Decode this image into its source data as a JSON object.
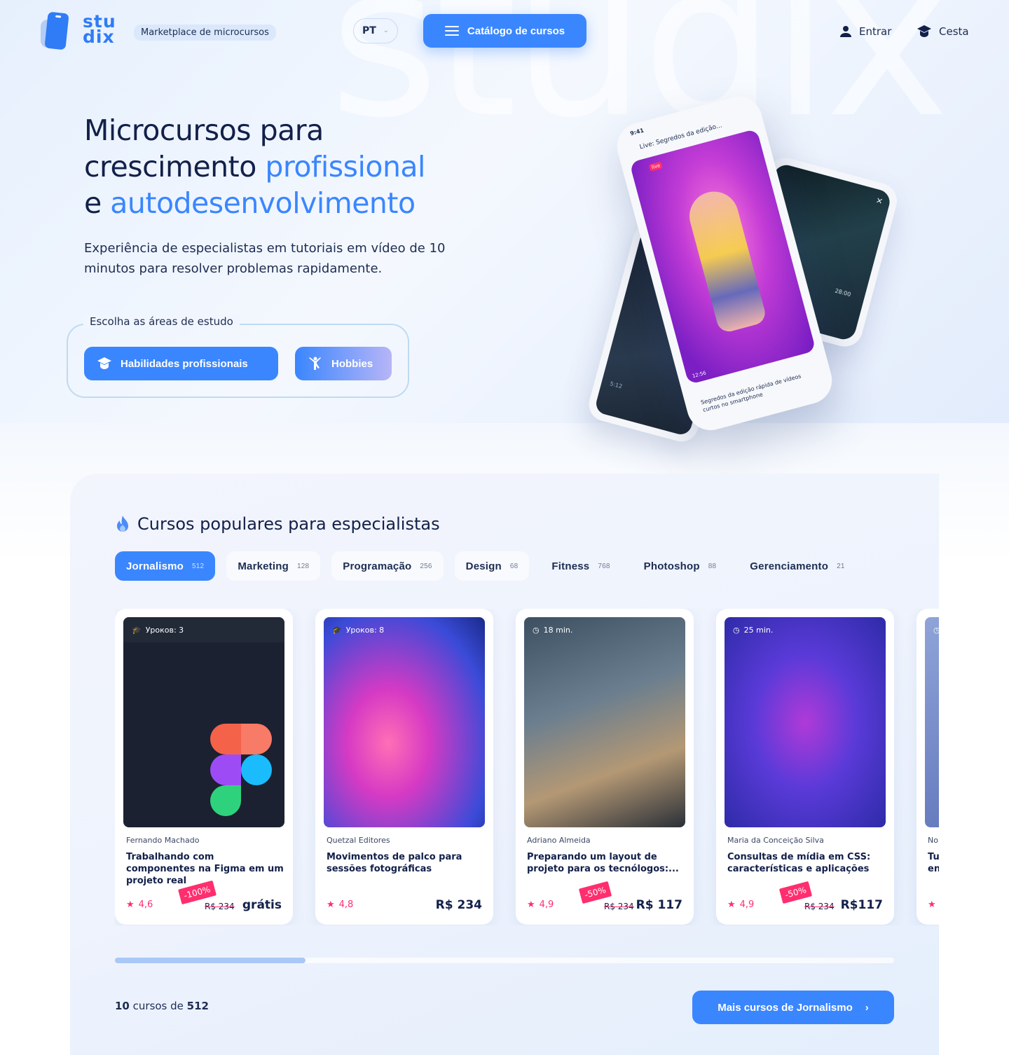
{
  "header": {
    "logo_line1": "stu",
    "logo_line2": "dix",
    "tagline": "Marketplace de microcursos",
    "language": "PT",
    "catalog_label": "Catálogo de cursos",
    "login_label": "Entrar",
    "cart_label": "Cesta",
    "watermark": "studix"
  },
  "hero": {
    "title_line1": "Microcursos para",
    "title_line2_a": "crescimento ",
    "title_line2_b": "profissional",
    "title_line3_a": "e ",
    "title_line3_b": "autodesenvolvimento",
    "subtitle": "Experiência de especialistas em tutoriais em vídeo de 10 minutos para resolver problemas rapidamente.",
    "areas_label": "Escolha as áreas de estudo",
    "areas": [
      {
        "label": "Habilidades profissionais",
        "icon": "graduation-cap-icon"
      },
      {
        "label": "Hobbies",
        "icon": "dance-icon"
      }
    ],
    "phone": {
      "time": "9:41",
      "live_title": "Live: Segredos da edição...",
      "live_tag": "live",
      "caption": "Segredos da edição rápida de vídeos curtos no smartphone",
      "timer": "12:56",
      "right_timer": "28:00",
      "left_timer": "5:12"
    }
  },
  "courses": {
    "title": "Cursos populares para especialistas",
    "tabs": [
      {
        "label": "Jornalismo",
        "count": "512",
        "active": true
      },
      {
        "label": "Marketing",
        "count": "128"
      },
      {
        "label": "Programação",
        "count": "256"
      },
      {
        "label": "Design",
        "count": "68"
      },
      {
        "label": "Fitness",
        "count": "768"
      },
      {
        "label": "Photoshop",
        "count": "88"
      },
      {
        "label": "Gerenciamento",
        "count": "21"
      }
    ],
    "cards": [
      {
        "badge": "Уроков: 3",
        "badge_icon": "graduation-cap-icon",
        "author": "Fernando Machado",
        "title": "Trabalhando com componentes na Figma em um projeto real",
        "rating": "4,6",
        "discount": "-100%",
        "old_price": "R$ 234",
        "price": "grátis"
      },
      {
        "badge": "Уроков: 8",
        "badge_icon": "graduation-cap-icon",
        "author": "Quetzal Editores",
        "title": "Movimentos de palco para sessões fotográficas",
        "rating": "4,8",
        "discount": "",
        "old_price": "",
        "price": "R$ 234"
      },
      {
        "badge": "18 min.",
        "badge_icon": "clock-icon",
        "author": "Adriano Almeida",
        "title": "Preparando um layout de projeto para os tecnólogos:...",
        "rating": "4,9",
        "discount": "-50%",
        "old_price": "R$ 234",
        "price": "R$ 117"
      },
      {
        "badge": "25 min.",
        "badge_icon": "clock-icon",
        "author": "Maria da Conceição Silva",
        "title": "Consultas de mídia em CSS: características e aplicações",
        "rating": "4,9",
        "discount": "-50%",
        "old_price": "R$ 234",
        "price": "R$117"
      },
      {
        "badge": "",
        "badge_icon": "clock-icon",
        "author": "No",
        "title": "Tu en",
        "rating": "",
        "discount": "",
        "old_price": "",
        "price": ""
      }
    ],
    "scroll_progress": 0.245,
    "count_shown": "10",
    "count_mid": " cursos de ",
    "count_total": "512",
    "more_label": "Mais cursos de Jornalismo"
  },
  "colors": {
    "accent": "#3a86ff",
    "text": "#12204a",
    "rating": "#ff2e6e"
  }
}
